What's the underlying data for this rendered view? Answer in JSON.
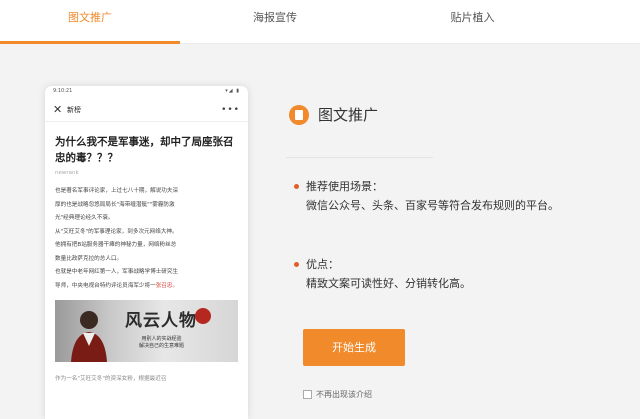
{
  "tabs": [
    {
      "label": "图文推广",
      "active": true
    },
    {
      "label": "海报宣传",
      "active": false
    },
    {
      "label": "贴片植入",
      "active": false
    }
  ],
  "colors": {
    "accent": "#f08a2b",
    "bullet": "#e35d2a",
    "highlight": "#d8453b"
  },
  "phone": {
    "status_time": "9:10:21",
    "status_icons": "▾◢ ▮",
    "nav_title": "新榜",
    "article_title": "为什么我不是军事迷，却中了局座张召忠的毒？？？",
    "source": "newrank",
    "body": [
      "也是著名军事评论家，上过七八十期，解说功夫深",
      "厚的也是战略忽悠局局长\"海带缠潜艇\"\"雾霾防激",
      "光\"经典理论经久不衰。",
      "从\"艾旺艾冬\"的军事理论家，到多次元网络大神。",
      "他拥有把B站服务器干瘫的神秘力量，网络粉丝总",
      "数量比政萨克拉的总人口。",
      "也就是中老年网红第一人，军事战略学博士研究生",
      "导师，中央电视台特约评论员海军少将一"
    ],
    "body_highlight": "张召忠。",
    "banner_title": "风云人物",
    "banner_sub": "用别人的实战经验",
    "banner_sub2": "解决自己的生意难题",
    "footer": "作为一名\"艾旺艾冬\"的资深女粉，根据最近召"
  },
  "panel": {
    "title": "图文推广",
    "scene_heading": "推荐使用场景：",
    "scene_body": "微信公众号、头条、百家号等符合发布规则的平台。",
    "adv_heading": "优点：",
    "adv_body": "精致文案可读性好、分销转化高。",
    "start_button": "开始生成",
    "no_show": "不再出现该介绍"
  }
}
